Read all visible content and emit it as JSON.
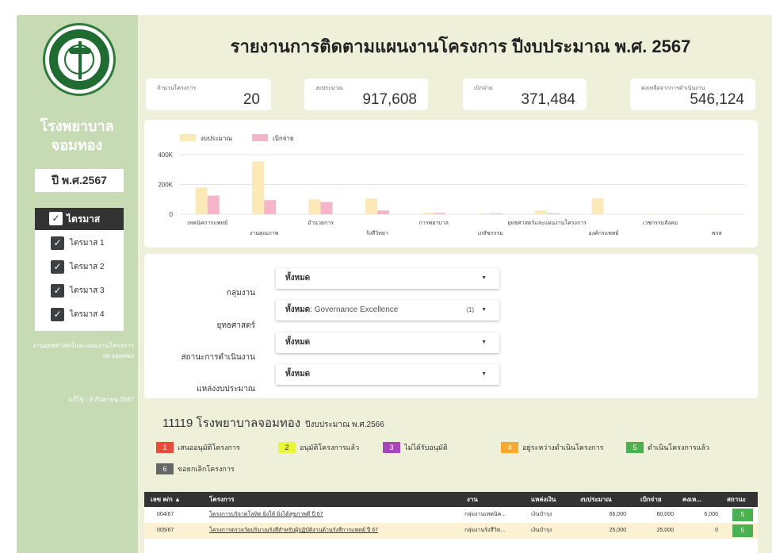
{
  "sidebar": {
    "hospital_name": "โรงพยาบาลจอมทอง",
    "year": "ปี พ.ศ.2567",
    "quarter_all": "ไตรมาส",
    "quarters": [
      "ไตรมาส 1",
      "ไตรมาส 2",
      "ไตรมาส 3",
      "ไตรมาส 4"
    ],
    "dept_text": "งานยุทธศาสตร์และแผนงานโครงการ รพ.จอมทอง",
    "updated": "แก้ไข : 9 กันยายน 2567"
  },
  "title": "รายงานการติดตามแผนงานโครงการ ปีงบประมาณ พ.ศ. 2567",
  "kpis": [
    {
      "label": "จำนวนโครงการ",
      "value": "20"
    },
    {
      "label": "งบประมาณ",
      "value": "917,608"
    },
    {
      "label": "เบิกจ่าย",
      "value": "371,484"
    },
    {
      "label": "คงเหลือจากการดำเนินงาน",
      "value": "546,124"
    }
  ],
  "chart_data": {
    "type": "bar",
    "categories": [
      "เทคนิคการแพทย์",
      "งานคุณภาพ",
      "อำนวยการ",
      "รังสีวิทยา",
      "การพยาบาล",
      "เภสัชกรรม",
      "ยุทธศาสตร์และแผนงานโครงการ",
      "องค์กรแพทย์",
      "เวชกรรมสังคม",
      "พรส"
    ],
    "series": [
      {
        "name": "งบประมาณ",
        "color": "#fbe9b7",
        "values": [
          180000,
          355000,
          100000,
          105000,
          10000,
          6000,
          25000,
          108000,
          3000,
          2000
        ]
      },
      {
        "name": "เบิกจ่าย",
        "color": "#f4b6c8",
        "values": [
          125000,
          95000,
          82000,
          25000,
          8000,
          5000,
          6000,
          0,
          0,
          0
        ]
      }
    ],
    "yticks": [
      "0",
      "200K",
      "400K"
    ],
    "ylim": [
      0,
      400000
    ],
    "legend": "top-left"
  },
  "filters": [
    {
      "label": "กลุ่มงาน",
      "value": "ทั้งหมด",
      "sub": "",
      "count": ""
    },
    {
      "label": "ยุทธศาสตร์",
      "value": "ทั้งหมด",
      "sub": ": Governance Excellence",
      "count": "(1)"
    },
    {
      "label": "สถานะการดำเนินงาน",
      "value": "ทั้งหมด",
      "sub": "",
      "count": ""
    },
    {
      "label": "แหล่งงบประมาณ",
      "value": "ทั้งหมด",
      "sub": "",
      "count": ""
    }
  ],
  "hospital_line": {
    "code_name": "11119 โรงพยาบาลจอมทอง",
    "fiscal": "ปีงบประมาณ พ.ศ.2566"
  },
  "status_legend": [
    {
      "num": "1",
      "label": "เสนออนุมัติโครงการ",
      "color": "#e94b3c",
      "text_color": "#ffffff"
    },
    {
      "num": "2",
      "label": "อนุมัติโครงการแล้ว",
      "color": "#e8f53a",
      "text_color": "#333333"
    },
    {
      "num": "3",
      "label": "ไม่ได้รับอนุมัติ",
      "color": "#a845b8",
      "text_color": "#ffffff"
    },
    {
      "num": "4",
      "label": "อยู่ระหว่างดำเนินโครงการ",
      "color": "#f7a930",
      "text_color": "#ffffff"
    },
    {
      "num": "5",
      "label": "ดำเนินโครงการแล้ว",
      "color": "#4caf50",
      "text_color": "#ffffff"
    },
    {
      "num": "6",
      "label": "ขอยกเลิกโครงการ",
      "color": "#666666",
      "text_color": "#ffffff"
    }
  ],
  "table": {
    "headers": [
      "เลข ค/ก ▲",
      "โครงการ",
      "งาน",
      "แหล่งเงิน",
      "งบประมาณ",
      "เบิกจ่าย",
      "คงเห...",
      "สถานะ"
    ],
    "rows": [
      {
        "id": "004/67",
        "name": "โครงการบริจาคโลหิต ยิ่งให้ ยิ่งได้สุขภาพดี ปี 67",
        "dept": "กลุ่มงานเทคนิค...",
        "source": "เงินบำรุง",
        "budget": "66,000",
        "spent": "60,000",
        "remain": "6,000",
        "status": "5"
      },
      {
        "id": "005/67",
        "name": "โครงการตรวจวัดปริมาณรังสีสำหรับผู้ปฏิบัติงานด้านรังสีการแพทย์ ปี 67",
        "dept": "กลุ่มงานรังสีวิท...",
        "source": "เงินบำรุง",
        "budget": "25,000",
        "spent": "25,000",
        "remain": "0",
        "status": "5"
      }
    ]
  }
}
